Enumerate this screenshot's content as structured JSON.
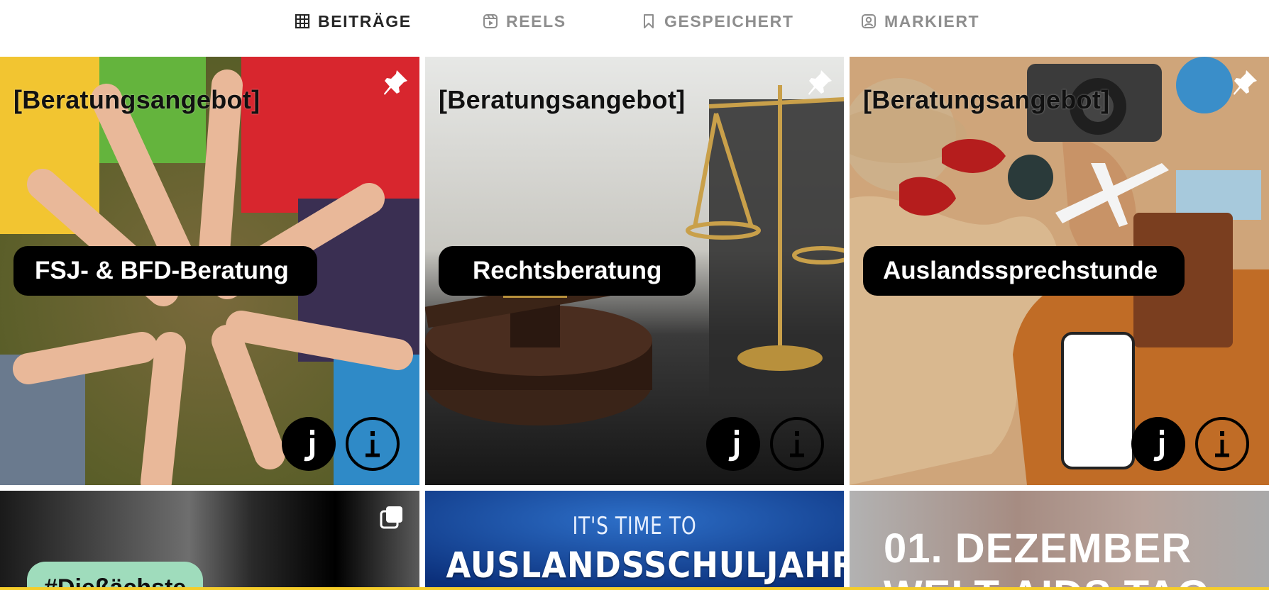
{
  "tabs": [
    {
      "label": "BEITRÄGE",
      "icon": "grid-icon",
      "active": true
    },
    {
      "label": "REELS",
      "icon": "reels-icon",
      "active": false
    },
    {
      "label": "GESPEICHERT",
      "icon": "bookmark-icon",
      "active": false
    },
    {
      "label": "MARKIERT",
      "icon": "tagged-person-icon",
      "active": false
    }
  ],
  "posts": [
    {
      "tag": "[Beratungsangebot]",
      "title": "FSJ- & BFD-Beratung",
      "pinned": true
    },
    {
      "tag": "[Beratungsangebot]",
      "title": "Rechtsberatung",
      "pinned": true
    },
    {
      "tag": "[Beratungsangebot]",
      "title": "Auslandssprechstunde",
      "pinned": true
    },
    {
      "chip": "#Dießächste",
      "type": "carousel"
    },
    {
      "line1": "IT'S TIME TO",
      "line2": "AUSLANDSSCHULJAHR"
    },
    {
      "line1": "01. DEZEMBER",
      "line2": "WELT AIDS TAG"
    }
  ],
  "colors": {
    "accent_bar": "#f5cd2a",
    "active_tab": "#262626",
    "inactive_tab": "#8e8e8e"
  }
}
